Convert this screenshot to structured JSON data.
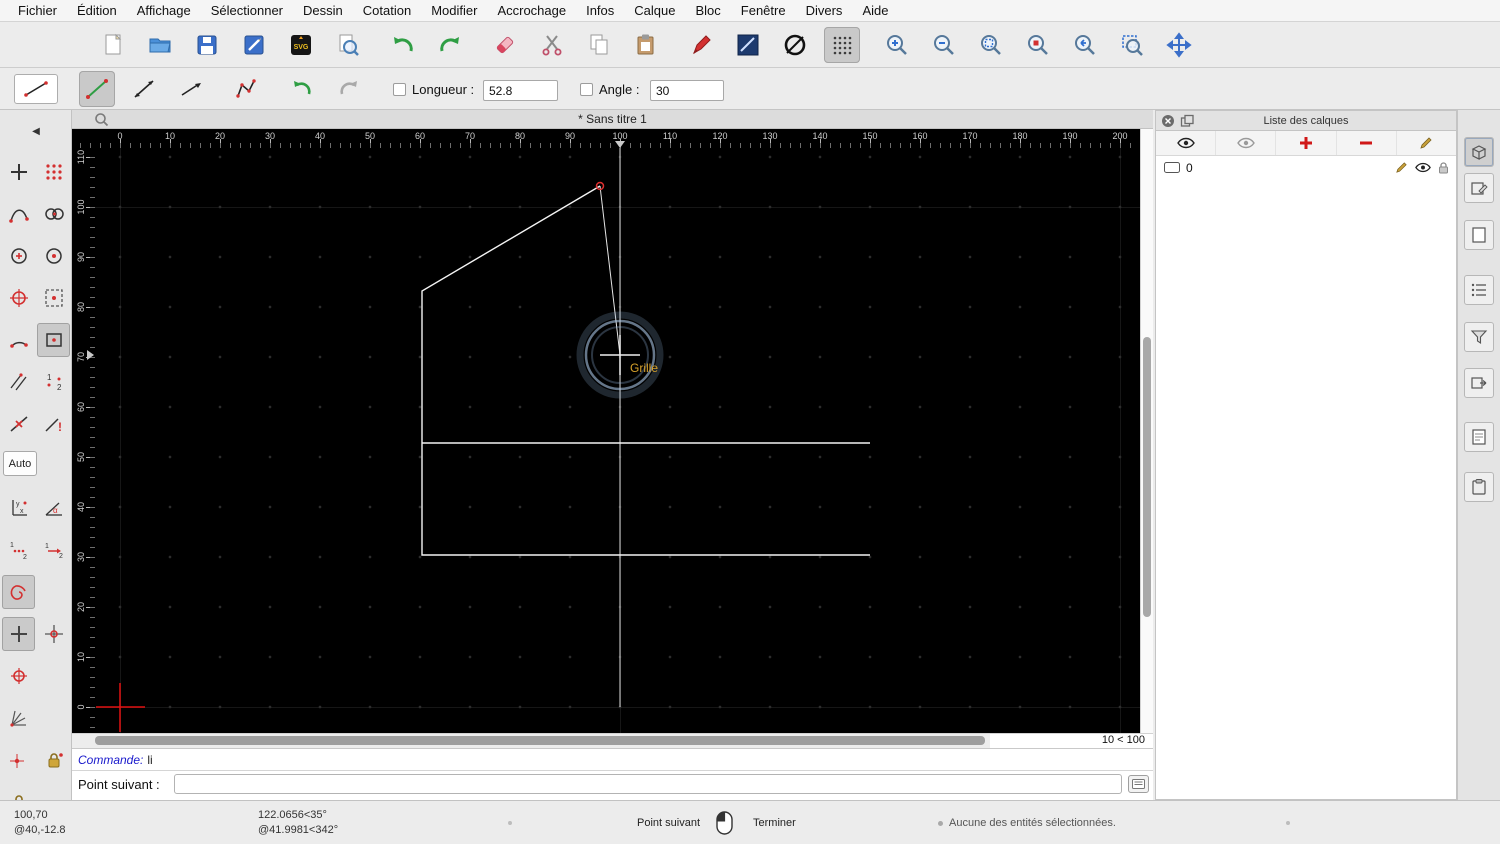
{
  "menu": {
    "items": [
      "Fichier",
      "Édition",
      "Affichage",
      "Sélectionner",
      "Dessin",
      "Cotation",
      "Modifier",
      "Accrochage",
      "Infos",
      "Calque",
      "Bloc",
      "Fenêtre",
      "Divers",
      "Aide"
    ]
  },
  "tool_options": {
    "length_label": "Longueur :",
    "length_value": "52.8",
    "angle_label": "Angle :",
    "angle_value": "30"
  },
  "palette": {
    "back_icon": "◀",
    "auto_label": "Auto"
  },
  "document": {
    "tab_title": "* Sans titre 1"
  },
  "rulers": {
    "horizontal": [
      "0",
      "10",
      "20",
      "30",
      "40",
      "50",
      "60",
      "70",
      "80",
      "90",
      "100",
      "110",
      "120",
      "130",
      "140",
      "150",
      "160",
      "170",
      "180",
      "190",
      "200"
    ],
    "vertical": [
      "110",
      "100",
      "90",
      "80",
      "70",
      "60",
      "50",
      "40",
      "30",
      "20",
      "10",
      "0"
    ]
  },
  "canvas": {
    "snap_tooltip": "Grille",
    "grid_status": "10 < 100"
  },
  "layers_panel": {
    "title": "Liste des calques",
    "layers": [
      {
        "name": "0"
      }
    ]
  },
  "command": {
    "prompt": "Commande:",
    "typed": "li",
    "prompt_line": "Point suivant :"
  },
  "statusbar": {
    "coords_abs": "100,70",
    "coords_rel": "@40,-12.8",
    "polar_abs": "122.0656<35°",
    "polar_rel": "@41.9981<342°",
    "left_click_action": "Point suivant",
    "right_click_action": "Terminer",
    "selection_info": "Aucune des entités sélectionnées."
  },
  "icons": {
    "svg_label": "SVG"
  },
  "colors": {
    "canvas_bg": "#000000",
    "draw_line": "#f2f2f2",
    "snap_ring": "#8fb0d8",
    "snap_label": "#d8a22b",
    "origin_cross": "#e01010",
    "accent_green": "#2f9e44",
    "accent_blue": "#3b6fc9",
    "accent_red": "#d33030"
  }
}
